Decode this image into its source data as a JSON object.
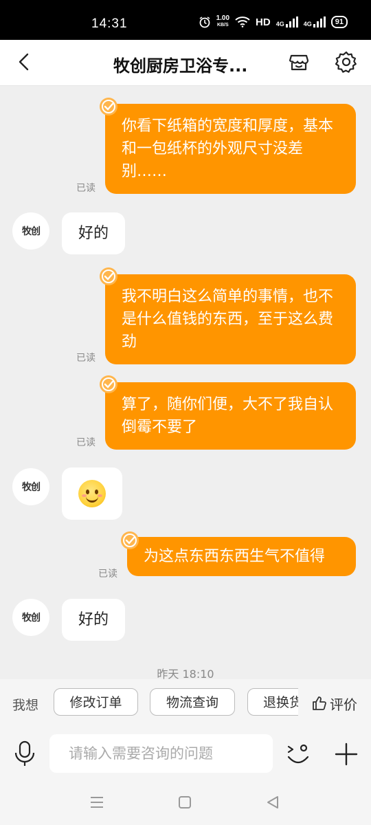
{
  "status_bar": {
    "time": "14:31",
    "net_speed_value": "1.00",
    "net_speed_unit": "KB/S",
    "hd_label": "HD",
    "network_1": "4G",
    "network_2": "4G",
    "battery": "91"
  },
  "header": {
    "title": "牧创厨房卫浴专..."
  },
  "avatar_text": "牧创",
  "messages": [
    {
      "side": "out",
      "text": "你看下纸箱的宽度和厚度，基本和一包纸杯的外观尺寸没差别……",
      "status": "已读"
    },
    {
      "side": "in",
      "text": "好的"
    },
    {
      "side": "out",
      "text": "我不明白这么简单的事情，也不是什么值钱的东西，至于这么费劲",
      "status": "已读"
    },
    {
      "side": "out",
      "text": "算了，随你们便，大不了我自认倒霉不要了",
      "status": "已读"
    },
    {
      "side": "in",
      "emoji": "smile"
    },
    {
      "side": "out",
      "text": "为这点东西东西生气不值得",
      "status": "已读"
    },
    {
      "side": "in",
      "text": "好的"
    }
  ],
  "timestamp": "昨天 18:10",
  "quick_actions": {
    "label": "我想",
    "chips": [
      "修改订单",
      "物流查询",
      "退换货"
    ],
    "rate_label": "评价"
  },
  "input": {
    "placeholder": "请输入需要咨询的问题"
  },
  "colors": {
    "accent": "#ff9500",
    "background": "#efefef"
  }
}
